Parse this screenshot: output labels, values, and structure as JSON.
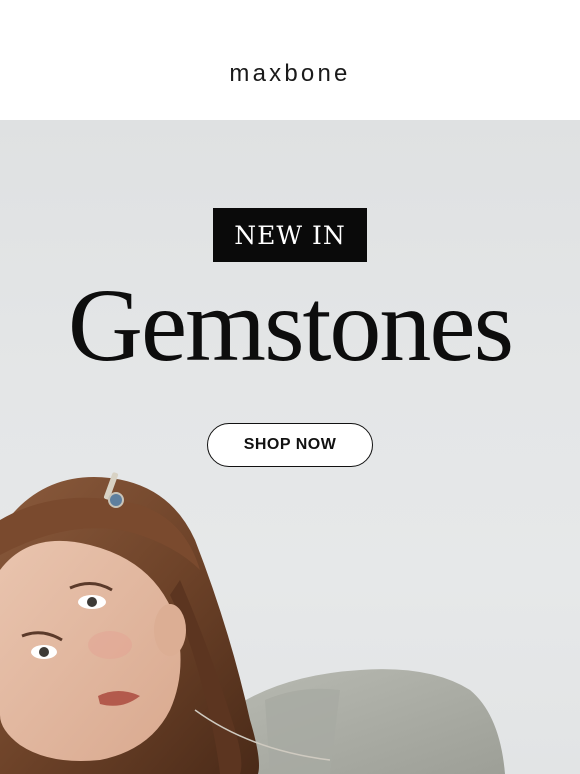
{
  "brand": {
    "logo_text": "maxbone"
  },
  "hero": {
    "badge": "NEW IN",
    "title": "Gemstones",
    "cta_label": "SHOP NOW"
  },
  "colors": {
    "hero_background": "#e3e5e6",
    "text": "#0d0d0d",
    "badge_background": "#0a0a0a",
    "button_background": "#ffffff"
  }
}
